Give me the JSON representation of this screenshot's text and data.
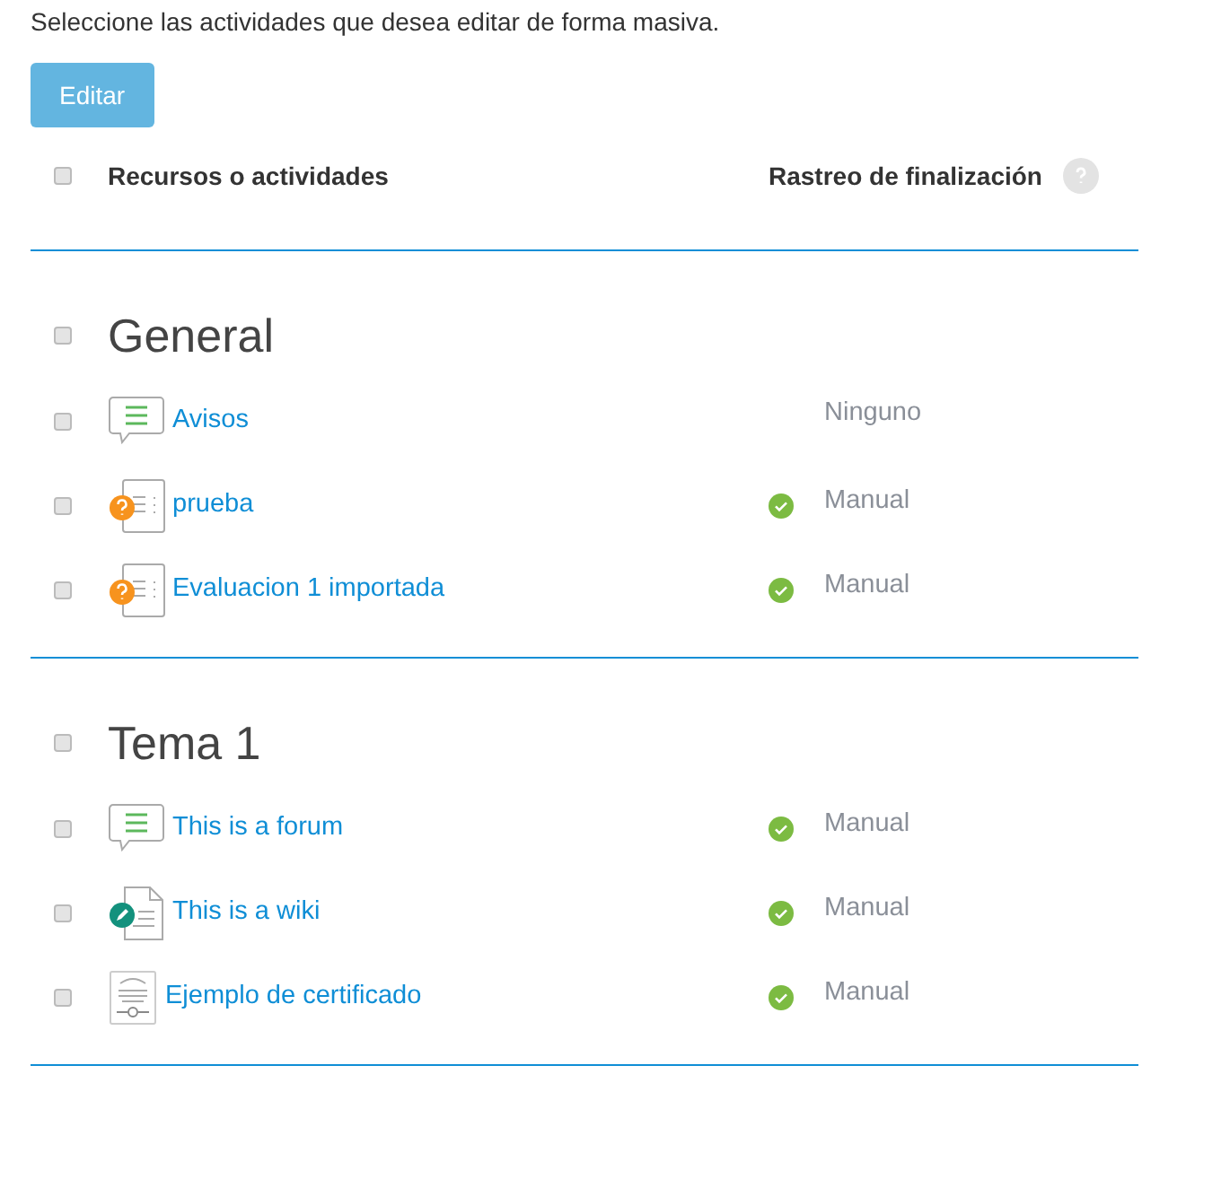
{
  "intro": "Seleccione las actividades que desea editar de forma masiva.",
  "edit_button": {
    "label": "Editar",
    "disabled": true
  },
  "header": {
    "checked": false,
    "columns": [
      "Recursos o actividades",
      "Rastreo de finalización"
    ]
  },
  "sections": [
    {
      "title": "General",
      "checked": false,
      "items": [
        {
          "kind": "forum",
          "name": "Avisos",
          "checked": false,
          "completion": "Ninguno",
          "tracked": false
        },
        {
          "kind": "quiz",
          "name": "prueba",
          "checked": false,
          "completion": "Manual",
          "tracked": true
        },
        {
          "kind": "quiz",
          "name": "Evaluacion 1 importada",
          "checked": false,
          "completion": "Manual",
          "tracked": true
        }
      ]
    },
    {
      "title": "Tema 1",
      "checked": false,
      "items": [
        {
          "kind": "forum",
          "name": "This is a forum",
          "checked": false,
          "completion": "Manual",
          "tracked": true
        },
        {
          "kind": "wiki",
          "name": "This is a wiki",
          "checked": false,
          "completion": "Manual",
          "tracked": true
        },
        {
          "kind": "certificate",
          "name": "Ejemplo de certificado",
          "checked": false,
          "completion": "Manual",
          "tracked": true
        }
      ]
    }
  ]
}
